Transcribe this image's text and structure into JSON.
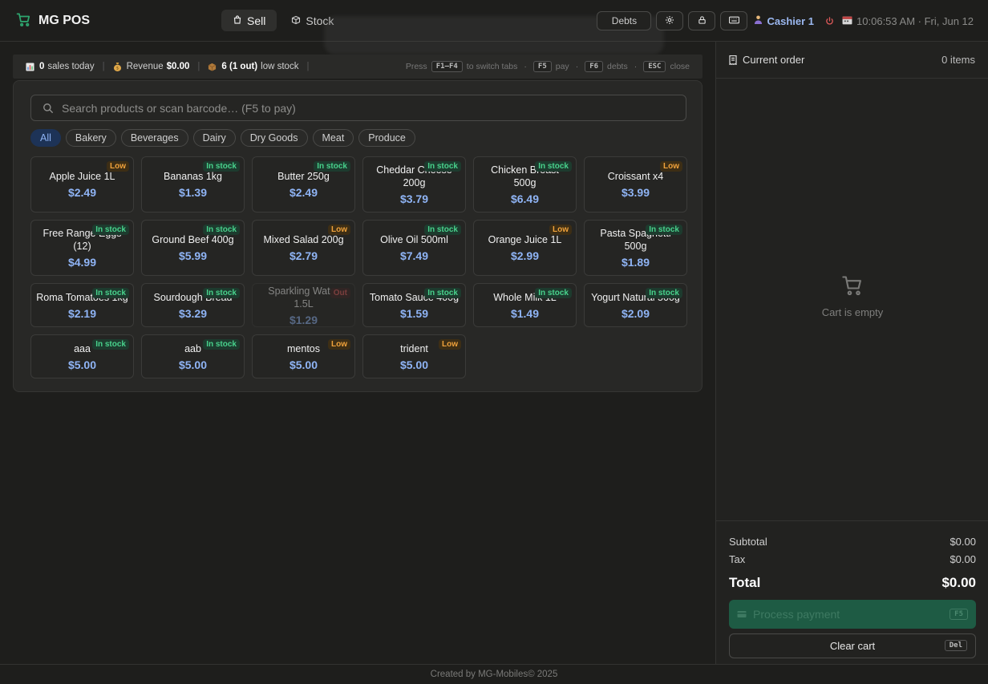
{
  "app": {
    "title": "MG POS"
  },
  "nav": {
    "tabs": [
      {
        "label": "Sell"
      },
      {
        "label": "Stock"
      }
    ]
  },
  "header": {
    "debts_label": "Debts",
    "cashier": "Cashier 1",
    "clock": "10:06:53 AM · Fri, Jun 12"
  },
  "stats": {
    "sales_count": "0",
    "sales_label": "sales today",
    "revenue_label": "Revenue",
    "revenue_value": "$0.00",
    "low_stock_value": "6 (1 out)",
    "low_stock_label": "low stock",
    "hint_press": "Press",
    "hint_tabs_key": "F1–F4",
    "hint_tabs_text": "to switch tabs",
    "hint_pay_key": "F5",
    "hint_pay_text": "pay",
    "hint_debts_key": "F6",
    "hint_debts_text": "debts",
    "hint_close_key": "ESC",
    "hint_close_text": "close"
  },
  "search": {
    "placeholder": "Search products or scan barcode… (F5 to pay)"
  },
  "categories": [
    "All",
    "Bakery",
    "Beverages",
    "Dairy",
    "Dry Goods",
    "Meat",
    "Produce"
  ],
  "products": [
    {
      "name": "Apple Juice 1L",
      "price": "$2.49",
      "badge": "Low"
    },
    {
      "name": "Bananas 1kg",
      "price": "$1.39",
      "badge": "In stock"
    },
    {
      "name": "Butter 250g",
      "price": "$2.49",
      "badge": "In stock"
    },
    {
      "name": "Cheddar Cheese 200g",
      "price": "$3.79",
      "badge": "In stock"
    },
    {
      "name": "Chicken Breast 500g",
      "price": "$6.49",
      "badge": "In stock"
    },
    {
      "name": "Croissant x4",
      "price": "$3.99",
      "badge": "Low"
    },
    {
      "name": "Free Range Eggs (12)",
      "price": "$4.99",
      "badge": "In stock"
    },
    {
      "name": "Ground Beef 400g",
      "price": "$5.99",
      "badge": "In stock"
    },
    {
      "name": "Mixed Salad 200g",
      "price": "$2.79",
      "badge": "Low"
    },
    {
      "name": "Olive Oil 500ml",
      "price": "$7.49",
      "badge": "In stock"
    },
    {
      "name": "Orange Juice 1L",
      "price": "$2.99",
      "badge": "Low"
    },
    {
      "name": "Pasta Spaghetti 500g",
      "price": "$1.89",
      "badge": "In stock"
    },
    {
      "name": "Roma Tomatoes 1kg",
      "price": "$2.19",
      "badge": "In stock"
    },
    {
      "name": "Sourdough Bread",
      "price": "$3.29",
      "badge": "In stock"
    },
    {
      "name": "Sparkling Water 1.5L",
      "price": "$1.29",
      "badge": "Out"
    },
    {
      "name": "Tomato Sauce 400g",
      "price": "$1.59",
      "badge": "In stock"
    },
    {
      "name": "Whole Milk 1L",
      "price": "$1.49",
      "badge": "In stock"
    },
    {
      "name": "Yogurt Natural 500g",
      "price": "$2.09",
      "badge": "In stock"
    },
    {
      "name": "aaa",
      "price": "$5.00",
      "badge": "In stock"
    },
    {
      "name": "aab",
      "price": "$5.00",
      "badge": "In stock"
    },
    {
      "name": "mentos",
      "price": "$5.00",
      "badge": "Low"
    },
    {
      "name": "trident",
      "price": "$5.00",
      "badge": "Low"
    }
  ],
  "cart": {
    "title": "Current order",
    "count": "0 items",
    "empty_text": "Cart is empty",
    "subtotal_label": "Subtotal",
    "subtotal_value": "$0.00",
    "tax_label": "Tax",
    "tax_value": "$0.00",
    "total_label": "Total",
    "total_value": "$0.00",
    "pay_label": "Process payment",
    "pay_key": "F5",
    "clear_label": "Clear cart",
    "clear_key": "Del"
  },
  "footer": {
    "text": "Created by MG-Mobiles© 2025"
  },
  "colors": {
    "accent": "#8fb4f5",
    "in_stock": "#48d28c",
    "low": "#f0a23b",
    "out": "#e05a5a",
    "brand": "#2ea66f"
  }
}
